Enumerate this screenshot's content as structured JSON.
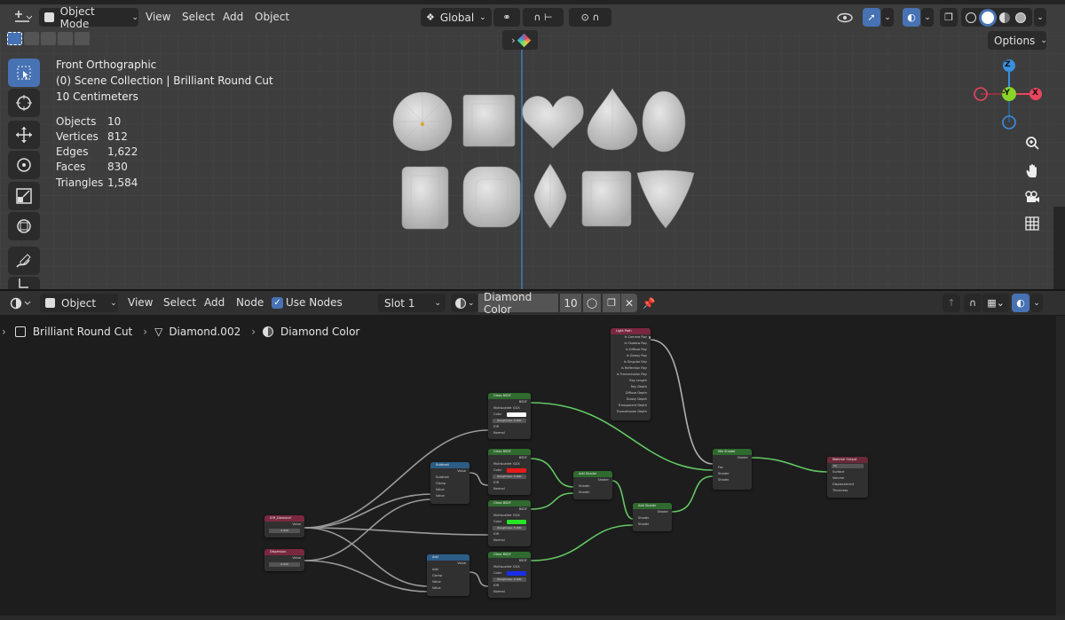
{
  "viewport": {
    "header": {
      "mode": "Object Mode",
      "menu": [
        "View",
        "Select",
        "Add",
        "Object"
      ],
      "transform": "Global",
      "options": "Options"
    },
    "overlay": {
      "view_name": "Front Orthographic",
      "collection": "(0) Scene Collection | Brilliant Round Cut",
      "scale": "10 Centimeters"
    },
    "stats": [
      {
        "label": "Objects",
        "value": "10"
      },
      {
        "label": "Vertices",
        "value": "812"
      },
      {
        "label": "Edges",
        "value": "1,622"
      },
      {
        "label": "Faces",
        "value": "830"
      },
      {
        "label": "Triangles",
        "value": "1,584"
      }
    ],
    "gizmo": {
      "z": "Z",
      "y": "-Y",
      "x": "X"
    },
    "colors": {
      "x_axis": "#e8455d",
      "y_axis": "#8bd32b",
      "z_axis": "#3a8ee0",
      "selected": "#4772b3"
    }
  },
  "node_editor": {
    "header": {
      "mode": "Object",
      "menu": [
        "View",
        "Select",
        "Add",
        "Node"
      ],
      "use_nodes": "Use Nodes",
      "slot": "Slot 1",
      "material": "Diamond Color",
      "users": "10"
    },
    "breadcrumb": [
      "Brilliant Round Cut",
      "Diamond.002",
      "Diamond Color"
    ],
    "nodes": {
      "light_path": {
        "title": "Light Path",
        "outputs": [
          "Is Camera Ray",
          "Is Shadow Ray",
          "Is Diffuse Ray",
          "Is Glossy Ray",
          "Is Singular Ray",
          "Is Reflection Ray",
          "Is Transmission Ray",
          "Ray Length",
          "Ray Depth",
          "Diffuse Depth",
          "Glossy Depth",
          "Transparent Depth",
          "Transmission Depth"
        ]
      },
      "glass1": {
        "title": "Glass BSDF",
        "out": "BSDF",
        "dist": "Multiscatter GGX",
        "color": "Color",
        "roughness": "Roughness: 0.000",
        "ior": "IOR",
        "normal": "Normal"
      },
      "glass2": {
        "title": "Glass BSDF",
        "out": "BSDF",
        "dist": "Multiscatter GGX",
        "color": "Color",
        "roughness": "Roughness: 0.000",
        "ior": "IOR",
        "normal": "Normal"
      },
      "glass3": {
        "title": "Glass BSDF",
        "out": "BSDF",
        "dist": "Multiscatter GGX",
        "color": "Color",
        "roughness": "Roughness: 0.000",
        "ior": "IOR",
        "normal": "Normal"
      },
      "glass4": {
        "title": "Glass BSDF",
        "out": "BSDF",
        "dist": "Multiscatter GGX",
        "color": "Color",
        "roughness": "Roughness: 0.000",
        "ior": "IOR",
        "normal": "Normal"
      },
      "subtract": {
        "title": "Subtract",
        "out": "Value",
        "op": "Subtract",
        "clamp": "Clamp",
        "in1": "Value",
        "in2": "Value"
      },
      "add": {
        "title": "Add",
        "out": "Value",
        "op": "Add",
        "clamp": "Clamp",
        "in1": "Value",
        "in2": "Value"
      },
      "ior_value": {
        "title": "IOR_Diamond",
        "out": "Value",
        "val": "2.420"
      },
      "dispersion": {
        "title": "Dispersion",
        "out": "Value",
        "val": "0.020"
      },
      "add_shader1": {
        "title": "Add Shader",
        "out": "Shader",
        "in1": "Shader",
        "in2": "Shader"
      },
      "add_shader2": {
        "title": "Add Shader",
        "out": "Shader",
        "in1": "Shader",
        "in2": "Shader"
      },
      "mix_shader": {
        "title": "Mix Shader",
        "out": "Shader",
        "fac": "Fac",
        "in1": "Shader",
        "in2": "Shader"
      },
      "output": {
        "title": "Material Output",
        "target": "All",
        "surface": "Surface",
        "volume": "Volume",
        "displacement": "Displacement",
        "thickness": "Thickness"
      }
    },
    "colors": {
      "swatch1": "#ffffff",
      "swatch2": "#e81a1a",
      "swatch3": "#27e427",
      "swatch4": "#1a2ee8",
      "shader_header": "#2f6a2f",
      "input_header": "#7a2840",
      "converter_header": "#2b5d86",
      "output_header": "#6a2838"
    }
  }
}
